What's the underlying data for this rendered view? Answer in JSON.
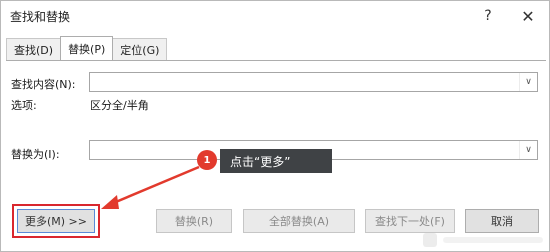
{
  "window": {
    "title": "查找和替换",
    "help_label": "?",
    "close_label": "✕"
  },
  "tabs": [
    {
      "label": "查找(D)",
      "active": false
    },
    {
      "label": "替换(P)",
      "active": true
    },
    {
      "label": "定位(G)",
      "active": false
    }
  ],
  "find": {
    "label": "查找内容(N):",
    "value": "",
    "options_label": "选项:",
    "options_value": "区分全/半角"
  },
  "replace": {
    "label": "替换为(I):",
    "value": ""
  },
  "callout": {
    "number": "1",
    "text": "点击“更多”"
  },
  "buttons": {
    "more": "更多(M) >>",
    "replace": "替换(R)",
    "replace_all": "全部替换(A)",
    "find_next": "查找下一处(F)",
    "cancel": "取消"
  },
  "colors": {
    "callout_red": "#e23a2d",
    "callout_bg": "#3f4245",
    "highlight_red": "#d9272e"
  }
}
